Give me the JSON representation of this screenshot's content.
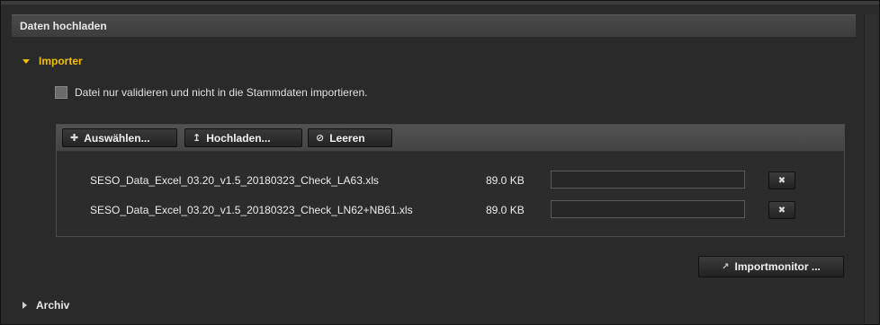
{
  "panel": {
    "title": "Daten hochladen"
  },
  "importer": {
    "label": "Importer",
    "validate_only_label": "Datei nur validieren und nicht in die Stammdaten importieren.",
    "validate_only_checked": false,
    "toolbar": {
      "select_label": "Auswählen...",
      "upload_label": "Hochladen...",
      "clear_label": "Leeren",
      "select_icon": "plus-icon",
      "upload_icon": "upload-arrow-icon",
      "clear_icon": "clear-circle-icon"
    },
    "files": [
      {
        "name": "SESO_Data_Excel_03.20_v1.5_20180323_Check_LA63.xls",
        "size": "89.0 KB",
        "progress": 0,
        "remove_icon": "close-icon"
      },
      {
        "name": "SESO_Data_Excel_03.20_v1.5_20180323_Check_LN62+NB61.xls",
        "size": "89.0 KB",
        "progress": 0,
        "remove_icon": "close-icon"
      }
    ],
    "monitor_button_label": "Importmonitor ...",
    "monitor_icon": "external-link-icon"
  },
  "archiv": {
    "label": "Archiv"
  },
  "colors": {
    "accent": "#f0c000",
    "background": "#2b2b2b",
    "header": "#454545"
  }
}
